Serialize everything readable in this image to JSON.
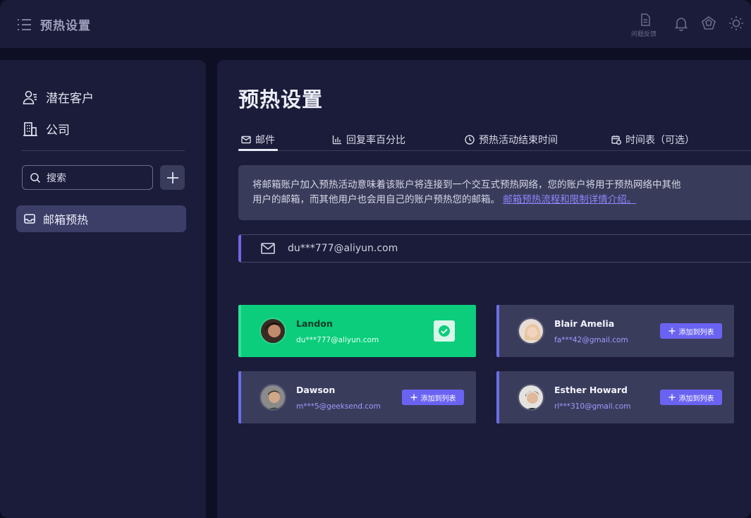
{
  "header": {
    "title": "预热设置",
    "feedback_label": "问题反馈"
  },
  "sidebar": {
    "items": [
      {
        "label": "潜在客户",
        "icon": "user-list-icon"
      },
      {
        "label": "公司",
        "icon": "building-icon"
      }
    ],
    "search_placeholder": "搜索",
    "active_item": {
      "label": "邮箱预热",
      "icon": "inbox-icon"
    }
  },
  "main": {
    "title": "预热设置",
    "tabs": [
      {
        "label": "邮件",
        "icon": "mail-icon",
        "active": true
      },
      {
        "label": "回复率百分比",
        "icon": "bar-chart-icon"
      },
      {
        "label": "预热活动结束时间",
        "icon": "clock-icon"
      },
      {
        "label": "时间表（可选）",
        "icon": "calendar-clock-icon"
      }
    ],
    "info": {
      "line1": "将邮箱账户加入预热活动意味着该账户将连接到一个交互式预热网络，您的账户将用于预热网络中其他",
      "line2": "用户的邮箱，而其他用户也会用自己的账户预热您的邮箱。",
      "link": "邮箱预热流程和限制详情介绍。"
    },
    "account_email": "du***777@aliyun.com",
    "add_button_label": "添加到列表",
    "cards": [
      {
        "name": "Landon",
        "email": "du***777@aliyun.com",
        "selected": true
      },
      {
        "name": "Blair Amelia",
        "email": "fa***42@gmail.com",
        "selected": false
      },
      {
        "name": "Dawson",
        "email": "m***5@geeksend.com",
        "selected": false
      },
      {
        "name": "Esther Howard",
        "email": "rl***310@gmail.com",
        "selected": false
      }
    ]
  },
  "colors": {
    "accent": "#6a63f2",
    "selected_card": "#0bcd7c",
    "background": "#1b1c3a",
    "link": "#8f86ff"
  }
}
